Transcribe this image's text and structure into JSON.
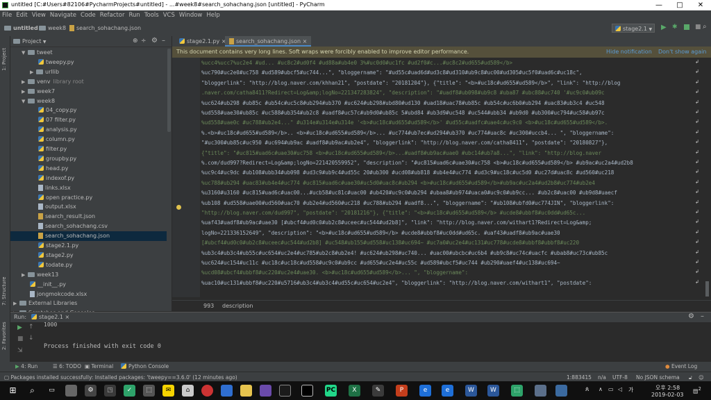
{
  "window": {
    "title": "untitled [C:#Users#82106#PycharmProjects#untitled] - ...#week8#search_sohachang.json [untitled] - PyCharm",
    "minimize": "—",
    "maximize": "□",
    "close": "✕"
  },
  "menu": [
    "File",
    "Edit",
    "View",
    "Navigate",
    "Code",
    "Refactor",
    "Run",
    "Tools",
    "VCS",
    "Window",
    "Help"
  ],
  "breadcrumb": [
    "untitled",
    "week8",
    "search_sohachang.json"
  ],
  "run_config": "stage2.1",
  "left_strip": {
    "project": "1: Project",
    "structure": "7: Structure",
    "favorites": "2: Favorites"
  },
  "project_panel": {
    "title": "Project",
    "items": [
      {
        "label": "tweet",
        "type": "folder",
        "open": true,
        "indent": 1
      },
      {
        "label": "tweepy.py",
        "type": "py",
        "indent": 3
      },
      {
        "label": "urllib",
        "type": "folder",
        "indent": 2
      },
      {
        "label": "venv",
        "suffix": "library root",
        "type": "folder",
        "indent": 1
      },
      {
        "label": "week7",
        "type": "folder",
        "indent": 1
      },
      {
        "label": "week8",
        "type": "folder",
        "open": true,
        "indent": 1
      },
      {
        "label": "04_copy.py",
        "type": "py",
        "indent": 3
      },
      {
        "label": "07 filter.py",
        "type": "py",
        "indent": 3
      },
      {
        "label": "analysis.py",
        "type": "py",
        "indent": 3
      },
      {
        "label": "column.py",
        "type": "py",
        "indent": 3
      },
      {
        "label": "filter.py",
        "type": "py",
        "indent": 3
      },
      {
        "label": "groupby.py",
        "type": "py",
        "indent": 3
      },
      {
        "label": "head.py",
        "type": "py",
        "indent": 3
      },
      {
        "label": "indexof.py",
        "type": "py",
        "indent": 3
      },
      {
        "label": "links.xlsx",
        "type": "file",
        "indent": 3
      },
      {
        "label": "open practice.py",
        "type": "py",
        "indent": 3
      },
      {
        "label": "output.xlsx",
        "type": "file",
        "indent": 3
      },
      {
        "label": "search_result.json",
        "type": "json",
        "indent": 3
      },
      {
        "label": "search_sohachang.csv",
        "type": "file",
        "indent": 3
      },
      {
        "label": "search_sohachang.json",
        "type": "json",
        "indent": 3,
        "selected": true
      },
      {
        "label": "stage2.1.py",
        "type": "py",
        "indent": 3
      },
      {
        "label": "stage2.py",
        "type": "py",
        "indent": 3
      },
      {
        "label": "todate.py",
        "type": "py",
        "indent": 3
      },
      {
        "label": "week13",
        "type": "folder",
        "indent": 1
      },
      {
        "label": "__init__.py",
        "type": "py",
        "indent": 2
      },
      {
        "label": "jongmokcode.xlsx",
        "type": "file",
        "indent": 2
      },
      {
        "label": "External Libraries",
        "type": "folder",
        "indent": 0
      },
      {
        "label": "Scratches and Consoles",
        "type": "folder",
        "indent": 0
      }
    ]
  },
  "editor": {
    "tabs": [
      "stage2.1.py",
      "search_sohachang.json"
    ],
    "banner": {
      "text": "This document contains very long lines. Soft wraps were forcibly enabled to improve editor performance.",
      "hide": "Hide notification",
      "dont_show": "Don't show again"
    },
    "lines": [
      "%ucc4%ucc7%uc2e4 #ud... #uc8c2#ud0f4 #ud88a#ub4e0 3%#uc0d0#uc1fc #ud2f0#c...#uc8c2#ud655#ud589</b>",
      "%uc790#uc2e0#uc758 #ud589#ubcf5#uc744...\", \"bloggername\": \"#ud55c#uad6d#ud3c8#ud310#ub9c8#uc00#ud305#uc5f0#uad6c#uc18c\",",
      "\"bloggerlink\": \"http://blog.naver.com/khhan21\", \"postdate\": \"20181204\"}, {\"title\": \"<b>#uc18c#ud655#ud589</b>\", \"link\": \"http://blog",
      ".naver.com/catha8411?Redirect=Log&amp;logNo=221347283824\", \"description\": \"#uadf8#ub098#ub9c8 #uba87 #ubc88#uc740 '#uc9c0#ub09c",
      "%uc624#ub298 #ub85c #ub54c#uc5c8#ub294#ub370 #uc624#ub298#ubd80#ud130 #uad18#uac78#ub85c #ub54c#uc6b0#ub294 #uac83#ub3c4 #uc548",
      "%ud558#uae30#ub85c #uc588#ub354#ub2c8 #uadf8#uc57c#ub9d0#ub85c 5#ubd84 #ub3d9#uc548 #uc544#ubb34 #ub9d0 #ub300#uc794#uc58#ub97c",
      "%ud558#uae0c #uc788#ub2e4...\" #u314e#u314e#u314e '<b>#uc18c#ud655#ud589</b>' #ud55c#uadfc#uae4c#uc9c0 <b>#uc18c#ud655#ud589</b>.",
      "%.<b>#uc18c#ud655#ud589</b>.. <b>#uc18c#ud655#ud589</b>... #uc774#ub7ec#ud294#ub370 #uc774#uac8c #uc300#uccb4... \", \"bloggername\":",
      "\"#uc300#ub85c#uc950 #uc694#ub9ac #uadf8#ub9ac#ub2e4\", \"bloggerlink\": \"http://blog.naver.com/catha8411\", \"postdate\": \"20180827\"},",
      "{\"title\": \"#uc815#uad6c#uae30#uc758 <b>#uc18c#ud655#ud589</b>...#uadf8#ub9ac#uae0 #ubc14#ub7a8...\", \"link\": \"http://blog.naver",
      "%.com/dud997?Redirect=Log&amp;logNo=221420559952\", \"description\": \"#uc815#uad6c#uae30#uc758 <b>#uc18c#ud655#ud589</b> #ub9ac#uc2a4#ud2b8",
      "%uc9c4#uc9dc #ub108#ubb34#ub098 #ud3c9#ub9c4#ud55c 20#ub300 #ucd08#ub818 #ub4e4#uc774 #ud3c9#uc18c#uc5d0 #uc27d#uac8c #ud560#uc218",
      "%uc788#ub294 #uac83#ub4e4#uc774 #uc815#uad6c#uae30#uc5d0#uac8c#ub294 <b>#uc18c#ud655#ud589</b>#ub9ac#uc2a4#ud2b8#uc774#ub2e4",
      "%u3160#u3160 #uc815#uad6c#uac00...#ucb58#uc81c#uac00 #ub420#uc9c0#ub294 #ubaa8#ub974#uaca0#uc9c0#ub9cc... #ub2c8#uac00 #ub9d8#uaecf",
      "%ub108 #ud558#uae00#ud560#uac70 #ub2e4#ud560#uc218 #uc788#ub294 #uadf8...\", \"bloggername\": \"#ub108#ubfd0#uc774JIN\", \"bloggerlink\":",
      "\"http://blog.naver.com/dud997\", \"postdate\": \"20181216\"}, {\"title\": \"<b>#uc18c#ud655#ud589</b> #ucde8#ubbf8#uc0dd#ud65c...",
      "%uaf43#uadf8#ub9ac#uae30 [#ubcf4#ud0c0#ub2c8#uceec#uc544#ud2b8]\", \"link\": \"http://blog.naver.com/withart1?Redirect=Log&amp;",
      "logNo=221336152649\", \"description\": \"<b>#uc18c#ud655#ud589</b> #ucde8#ubbf8#uc0dd#ud65c. #uaf43#uadf8#ub9ac#uae30",
      "[#ubcf4#ud0c0#ub2c8#uceec#uc544#ud2b8] #uc548#ub155#ud558#uc138#uc694~ #uc7a0#uc2e4#uc131#uc778#ucde8#ubbf8#ubbf8#uc220",
      "%ub3c4#ub3c4#ub55c#uc654#uc2e4#uc785#ub2c8#ub2e4! #uc624#ub298#uc740... #uac00#ubcbc#uc6b4 #ub9c8#uc74c#uacfc #ubab8#uc73c#ub85c",
      "%uc624#uc154#uc11c #uc18c#uc18c#ud558#uc9c0#ub9cc #ud655#uc2e4#uc55c #ud589#ubcf5#uc744 #ub290#uaef4#uc138#uc694~",
      "%ucd08#ubcf4#ubbf8#uc220#uc2e4#uae30. <b>#uc18c#ud655#ud589</b>... \", \"bloggername\":",
      "%uac10#uc131#ubbf8#uc220#u5716#ub3c4#ub3c4#ud55c#uc654#uc2e4\", \"bloggerlink\": \"http://blog.naver.com/withart1\", \"postdate\":"
    ],
    "footer_line": "993",
    "footer_path": "description"
  },
  "run": {
    "label": "Run:",
    "config": "stage2.1",
    "output_count": "1000",
    "finished": "Process finished with exit code 0"
  },
  "bottom_tabs": [
    "4: Run",
    "6: TODO",
    "Terminal",
    "Python Console"
  ],
  "event_log": "Event Log",
  "status": {
    "message": "Packages installed successfully: Installed packages: 'tweepy==3.6.0' (12 minutes ago)",
    "position": "1:883415",
    "na": "n/a",
    "encoding": "UTF-8",
    "schema": "No JSON schema"
  },
  "taskbar": {
    "time": "오후 2:58",
    "date": "2019-02-03",
    "notifications": "2",
    "ime": "가"
  },
  "colors": {
    "accent": "#4a88c7",
    "run_green": "#59a869",
    "banner_bg": "#55503b"
  }
}
